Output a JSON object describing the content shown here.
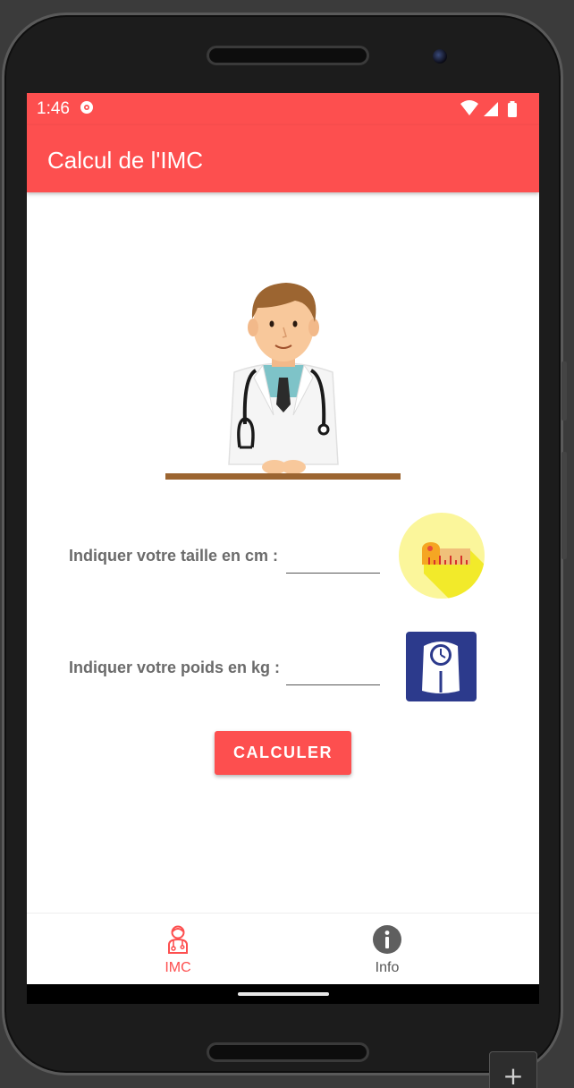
{
  "status_bar": {
    "time": "1:46",
    "icons": [
      "notification-icon",
      "wifi-icon",
      "signal-icon",
      "battery-icon"
    ]
  },
  "app_bar": {
    "title": "Calcul de l'IMC",
    "color": "#fd4f4f"
  },
  "form": {
    "height_label": "Indiquer votre taille en cm :",
    "height_value": "",
    "weight_label": "Indiquer votre poids en kg :",
    "weight_value": "",
    "submit_label": "CALCULER"
  },
  "bottom_nav": {
    "items": [
      {
        "label": "IMC",
        "icon": "doctor-icon",
        "active": true
      },
      {
        "label": "Info",
        "icon": "info-icon",
        "active": false
      }
    ]
  },
  "colors": {
    "accent": "#fd4f4f",
    "label_text": "#6b6b6b",
    "scale_icon_bg": "#2c3a8c"
  },
  "device": {
    "add_button_label": "+"
  }
}
